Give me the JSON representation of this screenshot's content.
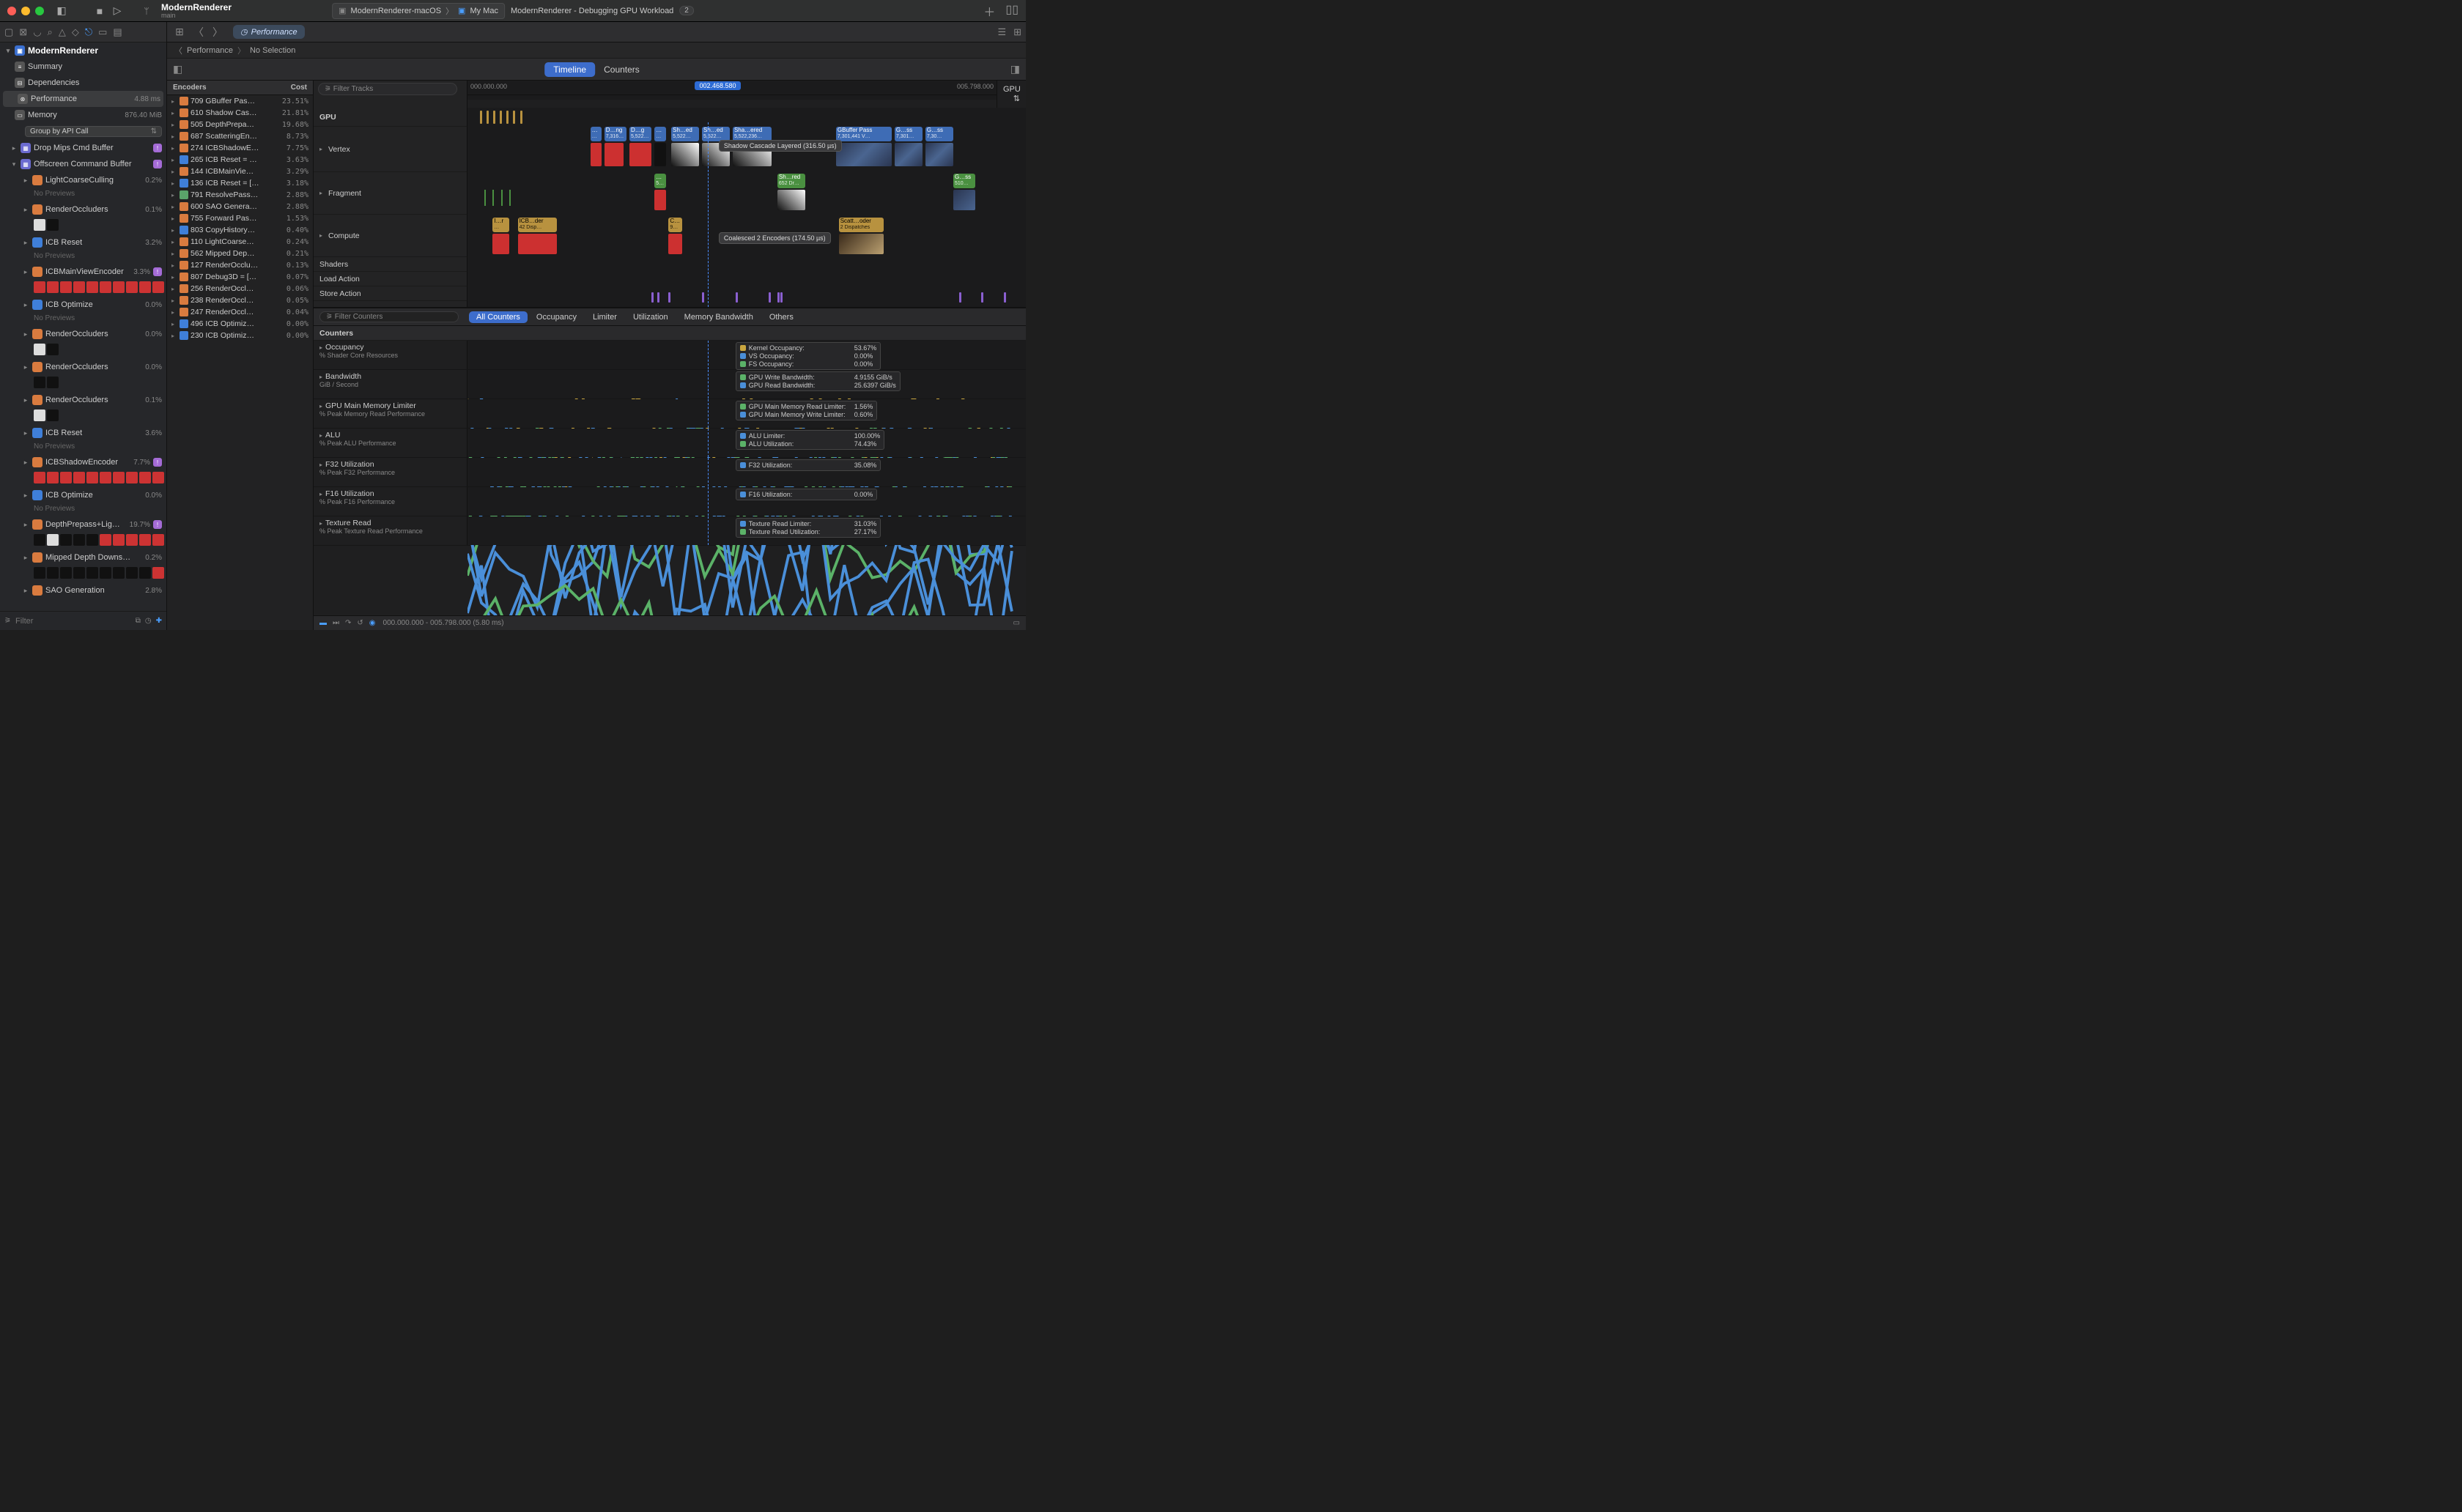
{
  "title": {
    "project": "ModernRenderer",
    "branch": "main"
  },
  "scheme": {
    "target": "ModernRenderer-macOS",
    "device": "My Mac"
  },
  "activity": "ModernRenderer - Debugging GPU Workload",
  "activity_badge": "2",
  "nav": {
    "project": "ModernRenderer",
    "categories": [
      {
        "icon": "≡",
        "label": "Summary"
      },
      {
        "icon": "⊟",
        "label": "Dependencies"
      },
      {
        "icon": "⊛",
        "label": "Performance",
        "val": "4.88 ms",
        "selected": true
      },
      {
        "icon": "▭",
        "label": "Memory",
        "val": "876.40 MiB"
      }
    ],
    "group_by": "Group by API Call",
    "tree": [
      {
        "type": "buf",
        "icon": "▦",
        "name": "Drop Mips Cmd Buffer",
        "warn": true
      },
      {
        "type": "buf",
        "icon": "▦",
        "name": "Offscreen Command Buffer",
        "warn": true,
        "open": true
      },
      {
        "type": "enc",
        "icon": "r",
        "name": "LightCoarseCulling",
        "val": "0.2%",
        "nopv": true
      },
      {
        "type": "enc",
        "icon": "r",
        "name": "RenderOccluders",
        "val": "0.1%",
        "thumbs": [
          "wh",
          "bl"
        ]
      },
      {
        "type": "enc",
        "icon": "b",
        "name": "ICB Reset",
        "val": "3.2%",
        "nopv": true
      },
      {
        "type": "enc",
        "icon": "r",
        "name": "ICBMainViewEncoder",
        "val": "3.3%",
        "warn": true,
        "thumbs": [
          "red",
          "red",
          "red",
          "red",
          "red",
          "red",
          "red",
          "red",
          "red",
          "red"
        ]
      },
      {
        "type": "enc",
        "icon": "b",
        "name": "ICB Optimize",
        "val": "0.0%",
        "nopv": true
      },
      {
        "type": "enc",
        "icon": "r",
        "name": "RenderOccluders",
        "val": "0.0%",
        "thumbs": [
          "wh",
          "bl"
        ]
      },
      {
        "type": "enc",
        "icon": "r",
        "name": "RenderOccluders",
        "val": "0.0%",
        "thumbs": [
          "bl",
          "bl"
        ]
      },
      {
        "type": "enc",
        "icon": "r",
        "name": "RenderOccluders",
        "val": "0.1%",
        "thumbs": [
          "wh",
          "bl"
        ]
      },
      {
        "type": "enc",
        "icon": "b",
        "name": "ICB Reset",
        "val": "3.6%",
        "nopv": true
      },
      {
        "type": "enc",
        "icon": "r",
        "name": "ICBShadowEncoder",
        "val": "7.7%",
        "warn": true,
        "thumbs": [
          "red",
          "red",
          "red",
          "red",
          "red",
          "red",
          "red",
          "red",
          "red",
          "red"
        ]
      },
      {
        "type": "enc",
        "icon": "b",
        "name": "ICB Optimize",
        "val": "0.0%",
        "nopv": true
      },
      {
        "type": "enc",
        "icon": "r",
        "name": "DepthPrepass+Lig…",
        "val": "19.7%",
        "warn": true,
        "thumbs": [
          "bl",
          "wh",
          "bl",
          "bl",
          "bl",
          "red",
          "red",
          "red",
          "red",
          "red"
        ]
      },
      {
        "type": "enc",
        "icon": "r",
        "name": "Mipped Depth Downs…",
        "val": "0.2%",
        "thumbs": [
          "bl",
          "bl",
          "bl",
          "bl",
          "bl",
          "bl",
          "bl",
          "bl",
          "bl",
          "red"
        ]
      },
      {
        "type": "enc",
        "icon": "r",
        "name": "SAO Generation",
        "val": "2.8%"
      }
    ],
    "filter_ph": "Filter"
  },
  "editor": {
    "tab_label": "Performance",
    "crumb": [
      "Performance",
      "No Selection"
    ]
  },
  "encoders": {
    "head": [
      "Encoders",
      "Cost"
    ],
    "rows": [
      {
        "ic": "r",
        "name": "709 GBuffer Pas…",
        "cost": "23.51%"
      },
      {
        "ic": "r",
        "name": "610 Shadow Cas…",
        "cost": "21.81%"
      },
      {
        "ic": "r",
        "name": "505 DepthPrepa…",
        "cost": "19.68%"
      },
      {
        "ic": "r",
        "name": "687 ScatteringEn…",
        "cost": "8.73%"
      },
      {
        "ic": "r",
        "name": "274 ICBShadowE…",
        "cost": "7.75%"
      },
      {
        "ic": "b",
        "name": "265 ICB Reset = …",
        "cost": "3.63%"
      },
      {
        "ic": "r",
        "name": "144 ICBMainVie…",
        "cost": "3.29%"
      },
      {
        "ic": "b",
        "name": "136 ICB Reset = […",
        "cost": "3.18%"
      },
      {
        "ic": "g",
        "name": "791 ResolvePass…",
        "cost": "2.88%"
      },
      {
        "ic": "r",
        "name": "600 SAO Genera…",
        "cost": "2.88%"
      },
      {
        "ic": "r",
        "name": "755 Forward Pas…",
        "cost": "1.53%"
      },
      {
        "ic": "b",
        "name": "803 CopyHistory…",
        "cost": "0.40%"
      },
      {
        "ic": "r",
        "name": "110 LightCoarse…",
        "cost": "0.24%"
      },
      {
        "ic": "r",
        "name": "562 Mipped Dep…",
        "cost": "0.21%"
      },
      {
        "ic": "r",
        "name": "127 RenderOcclu…",
        "cost": "0.13%"
      },
      {
        "ic": "r",
        "name": "807 Debug3D = […",
        "cost": "0.07%"
      },
      {
        "ic": "r",
        "name": "256 RenderOccl…",
        "cost": "0.06%"
      },
      {
        "ic": "r",
        "name": "238 RenderOccl…",
        "cost": "0.05%"
      },
      {
        "ic": "r",
        "name": "247 RenderOccl…",
        "cost": "0.04%"
      },
      {
        "ic": "b",
        "name": "496 ICB Optimiz…",
        "cost": "0.00%"
      },
      {
        "ic": "b",
        "name": "230 ICB Optimiz…",
        "cost": "0.00%"
      }
    ]
  },
  "tl": {
    "segs": [
      "Timeline",
      "Counters"
    ],
    "filter_tracks_ph": "Filter Tracks",
    "gpu_label": "GPU",
    "tracks": [
      "GPU",
      "Vertex",
      "Fragment",
      "Compute",
      "Shaders",
      "Load Action",
      "Store Action"
    ],
    "time_start": "000.000.000",
    "time_end": "005.798.000",
    "time_cursor": "002.468.580",
    "tooltip_shadow": "Shadow Cascade Layered (316.50 µs)",
    "tooltip_coalesced": "Coalesced 2 Encoders (174.50 µs)",
    "vertex_blocks": [
      {
        "x": 22,
        "w": 2,
        "c": "#3e6cb5",
        "t": "…",
        "s": "…"
      },
      {
        "x": 24.5,
        "w": 4,
        "c": "#3e6cb5",
        "t": "D…ng",
        "s": "7,316…"
      },
      {
        "x": 29,
        "w": 4,
        "c": "#3e6cb5",
        "t": "D…g",
        "s": "5,522…"
      },
      {
        "x": 33.5,
        "w": 2,
        "c": "#3e6cb5",
        "t": "…",
        "s": "…"
      },
      {
        "x": 36.5,
        "w": 5,
        "c": "#3e6cb5",
        "t": "Sh…ed",
        "s": "5,522…"
      },
      {
        "x": 42,
        "w": 5,
        "c": "#3e6cb5",
        "t": "Sh…ed",
        "s": "5,522…"
      },
      {
        "x": 47.5,
        "w": 7,
        "c": "#3e6cb5",
        "t": "Sha…ered",
        "s": "5,522,236…"
      },
      {
        "x": 66,
        "w": 10,
        "c": "#3e6cb5",
        "t": "GBuffer Pass",
        "s": "7,301,441 V…"
      },
      {
        "x": 76.5,
        "w": 5,
        "c": "#3e6cb5",
        "t": "G…ss",
        "s": "7,301…"
      },
      {
        "x": 82,
        "w": 5,
        "c": "#3e6cb5",
        "t": "G…ss",
        "s": "7,30…"
      }
    ],
    "vertex_thumbs": [
      {
        "x": 22,
        "w": 2,
        "c": "#cc3030"
      },
      {
        "x": 24.5,
        "w": 3.5,
        "c": "#cc3030"
      },
      {
        "x": 29,
        "w": 4,
        "c": "#cc3030"
      },
      {
        "x": 33.5,
        "w": 2,
        "c": "#111"
      },
      {
        "x": 36.5,
        "w": 5,
        "c": "linear-gradient(45deg,#111,#fff)"
      },
      {
        "x": 42,
        "w": 5,
        "c": "linear-gradient(45deg,#111,#fff)"
      },
      {
        "x": 47.5,
        "w": 7,
        "c": "linear-gradient(45deg,#111,#fff)"
      },
      {
        "x": 66,
        "w": 10,
        "c": "url"
      },
      {
        "x": 76.5,
        "w": 5,
        "c": "url"
      },
      {
        "x": 82,
        "w": 5,
        "c": "url"
      }
    ],
    "fragment_blocks": [
      {
        "x": 33.5,
        "w": 2,
        "c": "#4a9040",
        "t": "…",
        "s": "5…"
      },
      {
        "x": 55.5,
        "w": 5,
        "c": "#4a9040",
        "t": "Sh…red",
        "s": "652 Dr…"
      },
      {
        "x": 87,
        "w": 4,
        "c": "#4a9040",
        "t": "G…ss",
        "s": "510…"
      }
    ],
    "compute_blocks": [
      {
        "x": 4.5,
        "w": 3,
        "c": "#b8923f",
        "t": "I…r",
        "s": "…"
      },
      {
        "x": 9,
        "w": 7,
        "c": "#b8923f",
        "t": "ICB…der",
        "s": "42 Disp…"
      },
      {
        "x": 36,
        "w": 2.5,
        "c": "#b8923f",
        "t": "C…",
        "s": "9…"
      },
      {
        "x": 66.5,
        "w": 8,
        "c": "#b8923f",
        "t": "Scatt…oder",
        "s": "2 Dispatches"
      }
    ]
  },
  "ctr": {
    "filter_ph": "Filter Counters",
    "tabs": [
      "All Counters",
      "Occupancy",
      "Limiter",
      "Utilization",
      "Memory Bandwidth",
      "Others"
    ],
    "head": "Counters",
    "rows": [
      {
        "name": "Occupancy",
        "sub": "% Shader Core Resources",
        "legend": [
          {
            "c": "#c9a63f",
            "k": "Kernel Occupancy:",
            "v": "53.67%"
          },
          {
            "c": "#4a8fd9",
            "k": "VS Occupancy:",
            "v": "0.00%"
          },
          {
            "c": "#5bb268",
            "k": "FS Occupancy:",
            "v": "0.00%"
          }
        ]
      },
      {
        "name": "Bandwidth",
        "sub": "GiB / Second",
        "legend": [
          {
            "c": "#5bb268",
            "k": "GPU Write Bandwidth:",
            "v": "4.9155 GiB/s"
          },
          {
            "c": "#4a8fd9",
            "k": "GPU Read Bandwidth:",
            "v": "25.6397 GiB/s"
          }
        ]
      },
      {
        "name": "GPU Main Memory Limiter",
        "sub": "% Peak Memory Read Performance",
        "legend": [
          {
            "c": "#5bb268",
            "k": "GPU Main Memory Read Limiter:",
            "v": "1.56%"
          },
          {
            "c": "#4a8fd9",
            "k": "GPU Main Memory Write Limiter:",
            "v": "0.60%"
          }
        ]
      },
      {
        "name": "ALU",
        "sub": "% Peak ALU Performance",
        "legend": [
          {
            "c": "#4a8fd9",
            "k": "ALU Limiter:",
            "v": "100.00%"
          },
          {
            "c": "#5bb268",
            "k": "ALU Utilization:",
            "v": "74.43%"
          }
        ]
      },
      {
        "name": "F32 Utilization",
        "sub": "% Peak F32 Performance",
        "legend": [
          {
            "c": "#4a8fd9",
            "k": "F32 Utilization:",
            "v": "35.08%"
          }
        ]
      },
      {
        "name": "F16 Utilization",
        "sub": "% Peak F16 Performance",
        "legend": [
          {
            "c": "#4a8fd9",
            "k": "F16 Utilization:",
            "v": "0.00%"
          }
        ]
      },
      {
        "name": "Texture Read",
        "sub": "% Peak Texture Read Performance",
        "legend": [
          {
            "c": "#4a8fd9",
            "k": "Texture Read Limiter:",
            "v": "31.03%"
          },
          {
            "c": "#5bb268",
            "k": "Texture Read Utilization:",
            "v": "27.17%"
          }
        ]
      }
    ]
  },
  "footer_time": "000.000.000 - 005.798.000 (5.80 ms)"
}
